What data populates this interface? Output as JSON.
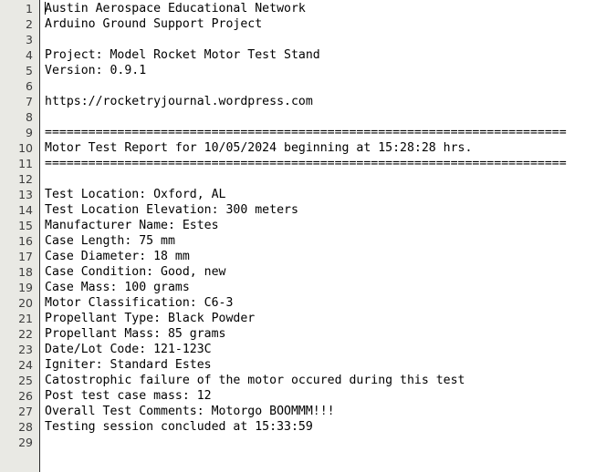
{
  "app": {
    "type": "plain-text-editor",
    "gutter_background": "#e9e9e4",
    "code_background": "#ffffff",
    "text_color": "#000000",
    "line_number_color": "#3c3c3c",
    "caret_color": "#000000",
    "caret_line": 1,
    "caret_column": 1,
    "total_lines": 29
  },
  "document": {
    "line_numbers": [
      "1",
      "2",
      "3",
      "4",
      "5",
      "6",
      "7",
      "8",
      "9",
      "10",
      "11",
      "12",
      "13",
      "14",
      "15",
      "16",
      "17",
      "18",
      "19",
      "20",
      "21",
      "22",
      "23",
      "24",
      "25",
      "26",
      "27",
      "28",
      "29"
    ],
    "lines": [
      "Austin Aerospace Educational Network",
      "Arduino Ground Support Project",
      "",
      "Project: Model Rocket Motor Test Stand",
      "Version: 0.9.1",
      "",
      "https://rocketryjournal.wordpress.com",
      "",
      "========================================================================",
      "Motor Test Report for 10/05/2024 beginning at 15:28:28 hrs.",
      "========================================================================",
      "",
      "Test Location: Oxford, AL",
      "Test Location Elevation: 300 meters",
      "Manufacturer Name: Estes",
      "Case Length: 75 mm",
      "Case Diameter: 18 mm",
      "Case Condition: Good, new",
      "Case Mass: 100 grams",
      "Motor Classification: C6-3",
      "Propellant Type: Black Powder",
      "Propellant Mass: 85 grams",
      "Date/Lot Code: 121-123C",
      "Igniter: Standard Estes",
      "Catostrophic failure of the motor occured during this test",
      "Post test case mass: 12",
      "Overall Test Comments: Motorgo BOOMMM!!!",
      "Testing session concluded at 15:33:59",
      ""
    ],
    "fields": {
      "header_title": "Austin Aerospace Educational Network",
      "header_subtitle": "Arduino Ground Support Project",
      "project": "Model Rocket Motor Test Stand",
      "version": "0.9.1",
      "url": "https://rocketryjournal.wordpress.com",
      "report_date": "10/05/2024",
      "report_start_time": "15:28:28",
      "test_location": "Oxford, AL",
      "test_location_elevation": "300 meters",
      "manufacturer_name": "Estes",
      "case_length": "75 mm",
      "case_diameter": "18 mm",
      "case_condition": "Good, new",
      "case_mass": "100 grams",
      "motor_classification": "C6-3",
      "propellant_type": "Black Powder",
      "propellant_mass": "85 grams",
      "date_lot_code": "121-123C",
      "igniter": "Standard Estes",
      "failure_note": "Catostrophic failure of the motor occured during this test",
      "post_test_case_mass": "12",
      "overall_test_comments": "Motorgo BOOMMM!!!",
      "session_concluded": "15:33:59"
    }
  }
}
